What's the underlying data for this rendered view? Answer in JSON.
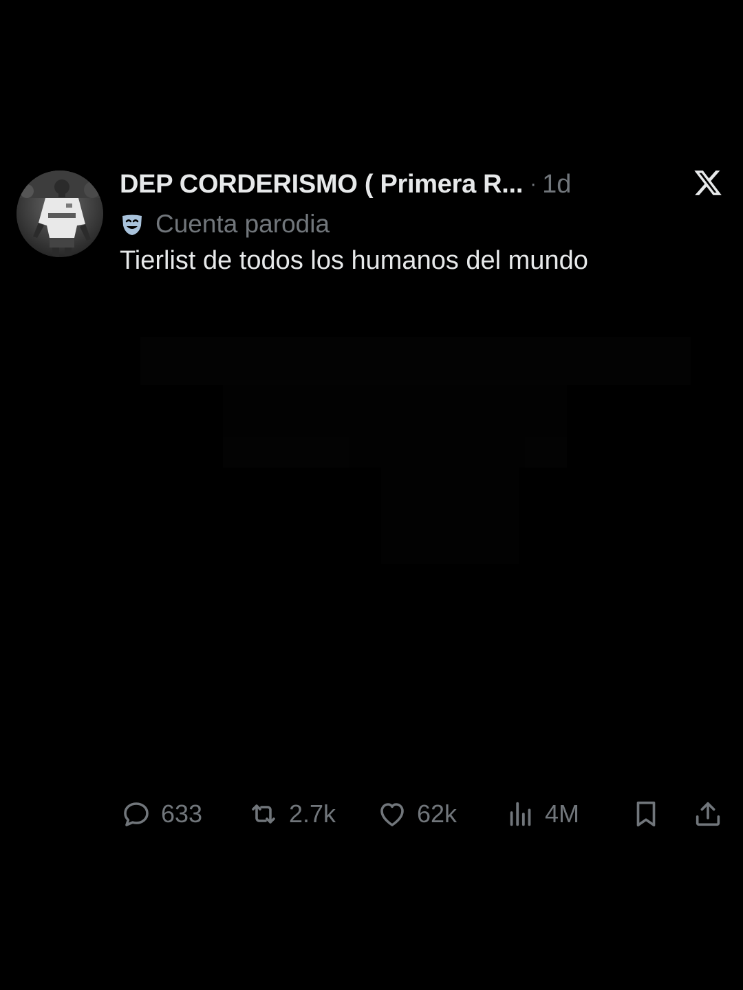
{
  "post": {
    "author": {
      "display_name": "DEP CORDERISMO ( Primera R...",
      "label_icon": "theater-mask-icon",
      "label": "Cuenta parodia"
    },
    "separator": "·",
    "time": "1d",
    "text": "Tierlist de todos los humanos del mundo",
    "brand_icon": "x-logo-icon"
  },
  "actions": {
    "replies": {
      "icon": "reply-bubble-icon",
      "count": "633"
    },
    "reposts": {
      "icon": "repost-icon",
      "count": "2.7k"
    },
    "likes": {
      "icon": "heart-icon",
      "count": "62k"
    },
    "views": {
      "icon": "views-chart-icon",
      "count": "4M"
    },
    "bookmark": {
      "icon": "bookmark-icon"
    },
    "share": {
      "icon": "share-icon"
    }
  },
  "colors": {
    "background": "#000000",
    "primary_text": "#e7e9ea",
    "secondary_text": "#71767b"
  }
}
